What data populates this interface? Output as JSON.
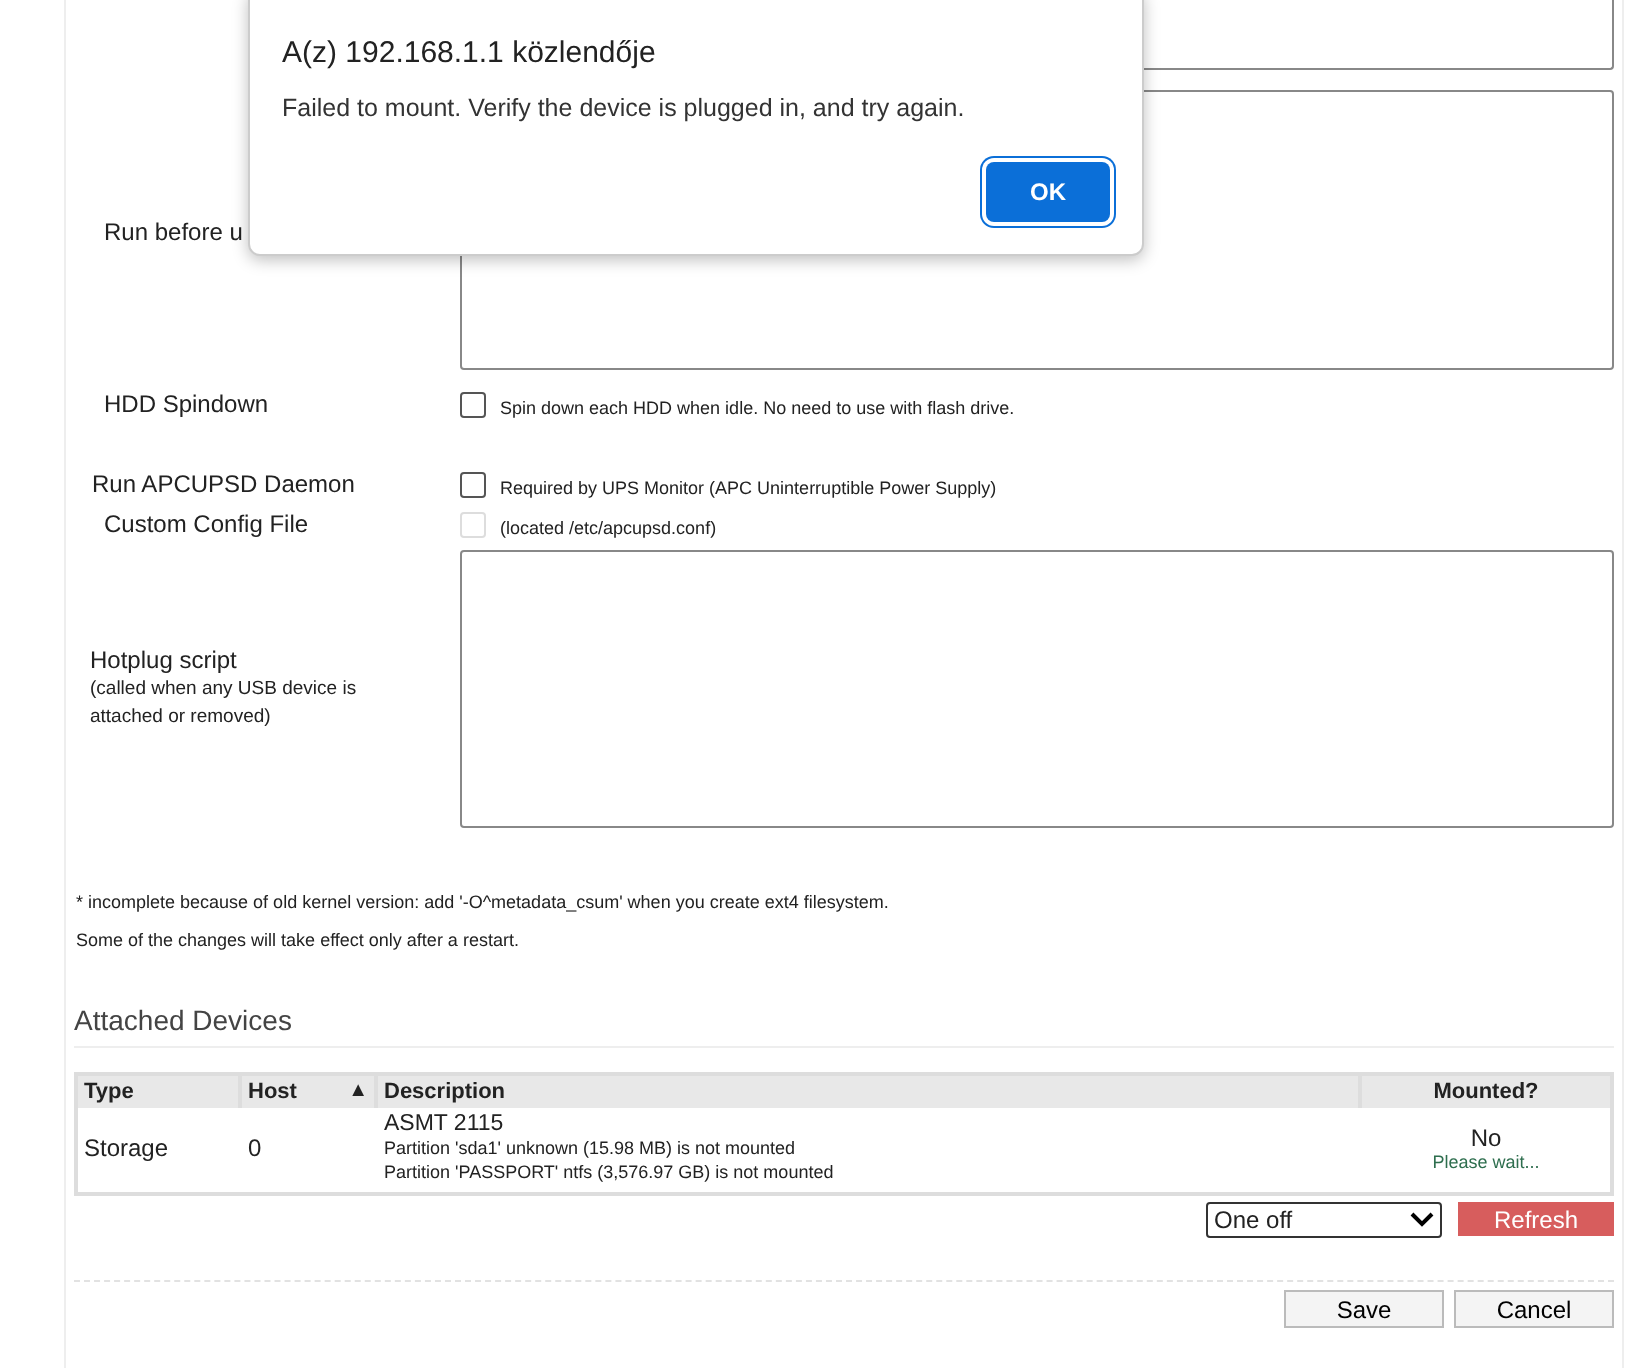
{
  "dialog": {
    "title": "A(z) 192.168.1.1 közlendője",
    "message": "Failed to mount. Verify the device is plugged in, and try again.",
    "ok_button": "OK"
  },
  "form": {
    "run_before_unmount_label": "Run before u",
    "rows": [
      {
        "kind": "checkbox",
        "label": "HDD Spindown",
        "text": "Spin down each HDD when idle. No need to use with flash drive.",
        "checked": false,
        "disabled": false
      },
      {
        "kind": "checkbox",
        "label": "Run APCUPSD Daemon",
        "text": "Required by UPS Monitor (APC Uninterruptible Power Supply)",
        "checked": false,
        "disabled": false
      },
      {
        "kind": "checkbox",
        "label": "Custom Config File",
        "text": "(located /etc/apcupsd.conf)",
        "checked": false,
        "disabled": true
      }
    ],
    "hotplug": {
      "label": "Hotplug script",
      "hint": "(called when any USB device is attached or removed)"
    }
  },
  "notes": [
    "* incomplete because of old kernel version: add '-O^metadata_csum' when you create ext4 filesystem.",
    "Some of the changes will take effect only after a restart."
  ],
  "attached_devices": {
    "title": "Attached Devices",
    "columns": [
      {
        "label": "Type"
      },
      {
        "label": "Host",
        "sort": "▲"
      },
      {
        "label": "Description"
      },
      {
        "label": "Mounted?"
      }
    ],
    "rows": [
      {
        "type": "Storage",
        "host": "0",
        "description": "ASMT 2115",
        "partitions": [
          "Partition 'sda1' unknown (15.98 MB) is not mounted",
          "Partition 'PASSPORT' ntfs (3,576.97 GB) is not mounted"
        ],
        "mounted": "No",
        "status": "Please wait..."
      }
    ],
    "refresh_select": "One off",
    "refresh_button": "Refresh"
  },
  "buttons": [
    "Save",
    "Cancel"
  ]
}
